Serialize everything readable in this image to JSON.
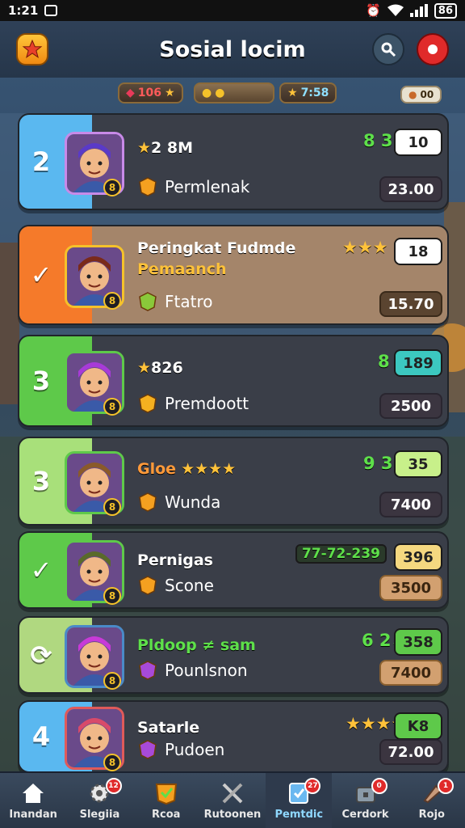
{
  "status_bar": {
    "time": "1:21",
    "battery": "86"
  },
  "header": {
    "title": "Sosial locim"
  },
  "resources": [
    {
      "value": "106"
    },
    {
      "value": "7:58"
    },
    {
      "value": "00"
    }
  ],
  "rows": [
    {
      "rank": "2",
      "name": "2 8M",
      "name_prefix": "★",
      "subtitle": "Permlenak",
      "trend": "8 3",
      "trend_arrow": "↗",
      "box": "10",
      "score": "23.00",
      "colors": {
        "band": "#5ab8f0",
        "frame": "#c88ae8",
        "box": "#ffffff",
        "bg": "#3a3e48"
      }
    },
    {
      "rank": "✓",
      "name": "Peringkat Fudmde",
      "name2": "Pemaanch",
      "subtitle": "Ftatro",
      "trend": "★★★",
      "box": "18",
      "score": "15.70",
      "colors": {
        "band": "#f57a2a",
        "frame": "#f5c22a",
        "box": "#ffffff",
        "bg": "#a4856a"
      }
    },
    {
      "rank": "3",
      "name": "826",
      "name_prefix": "★",
      "subtitle": "Premdoott",
      "trend": "8 4",
      "trend_arrow": "↗",
      "box": "189",
      "score": "2500",
      "colors": {
        "band": "#5ec94a",
        "frame": "#5ec94a",
        "box": "#3cc8c0",
        "bg": "#3a3e48"
      }
    },
    {
      "rank": "3",
      "name": "Gloe",
      "name_stars": "★★★★",
      "subtitle": "Wunda",
      "trend": "9 3",
      "trend_arrow": "↗",
      "box": "35",
      "score": "7400",
      "colors": {
        "band": "#a8e07a",
        "frame": "#5ec94a",
        "box": "#c8f08a",
        "bg": "#3a3e48"
      }
    },
    {
      "rank": "✓",
      "name": "Pernigas",
      "subtitle": "Scone",
      "trend": "77-72-239",
      "box": "396",
      "score": "3500",
      "colors": {
        "band": "#5ec94a",
        "frame": "#5ec94a",
        "box": "#f5d880",
        "bg": "#3a3e48"
      }
    },
    {
      "rank": "⟳",
      "name": "Pldoop ≠ sam",
      "subtitle": "Pounlsnon",
      "trend": "6 2",
      "trend_arrow": "↗",
      "box": "358",
      "score": "7400",
      "colors": {
        "band": "#b0d880",
        "frame": "#4a8ac8",
        "box": "#5ec94a",
        "bg": "#3a3e48"
      }
    },
    {
      "rank": "4",
      "name": "Satarle",
      "subtitle": "Pudoen",
      "trend": "★★★★",
      "box": "K8",
      "score": "72.00",
      "colors": {
        "band": "#5ab8f0",
        "frame": "#e05a5a",
        "box": "#5ec94a",
        "bg": "#3a3e48"
      }
    }
  ],
  "tabs": [
    {
      "label": "Inandan",
      "icon": "home-icon",
      "badge": ""
    },
    {
      "label": "Slegiia",
      "icon": "gear-icon",
      "badge": "12"
    },
    {
      "label": "Rcoa",
      "icon": "check-shield-icon",
      "badge": ""
    },
    {
      "label": "Rutoonen",
      "icon": "crossed-swords-icon",
      "badge": ""
    },
    {
      "label": "Pemtdic",
      "icon": "card-icon",
      "badge": "27"
    },
    {
      "label": "Cerdork",
      "icon": "chest-icon",
      "badge": "0"
    },
    {
      "label": "Rojo",
      "icon": "horn-icon",
      "badge": "1"
    }
  ]
}
